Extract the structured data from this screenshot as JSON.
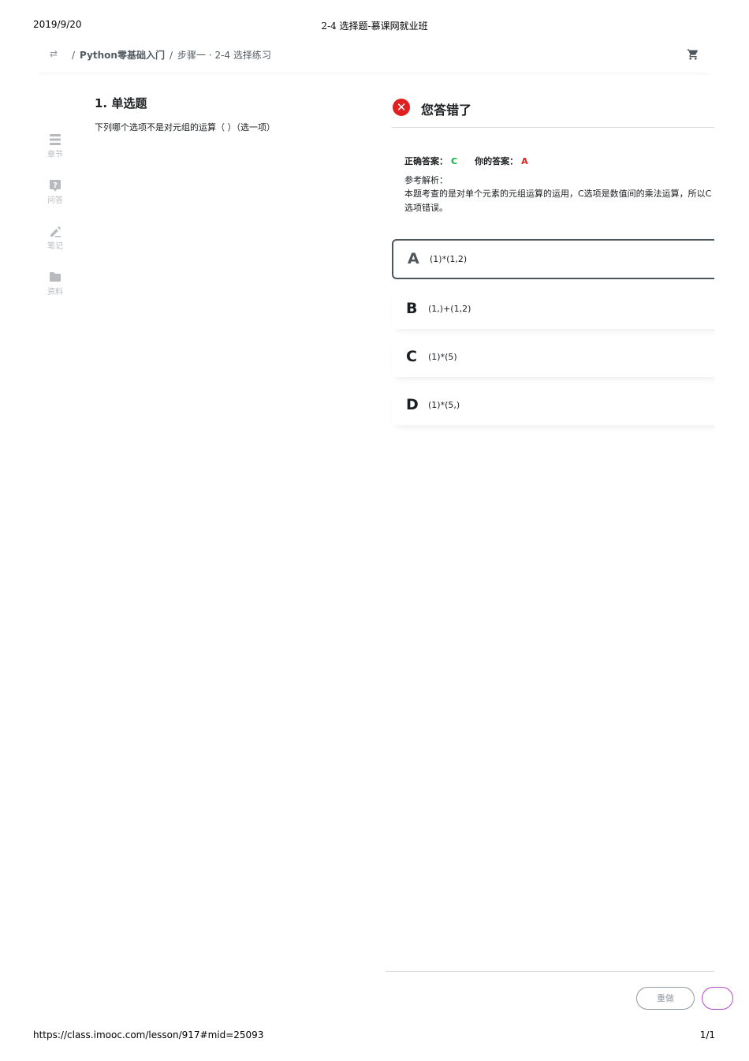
{
  "print": {
    "date": "2019/9/20",
    "title": "2-4 选择题-慕课网就业班",
    "url": "https://class.imooc.com/lesson/917#mid=25093",
    "page": "1/1"
  },
  "topbar": {
    "switch_icon": "swap-icon",
    "separator": "/",
    "course": "Python零基础入门",
    "lesson": "步骤一 · 2-4 选择练习",
    "cart_icon": "cart-icon"
  },
  "sidebar": {
    "items": [
      {
        "label": "章节",
        "icon": "list-icon"
      },
      {
        "label": "问答",
        "icon": "question-icon"
      },
      {
        "label": "笔记",
        "icon": "pencil-icon"
      },
      {
        "label": "资料",
        "icon": "folder-icon"
      }
    ]
  },
  "question": {
    "title": "1. 单选题",
    "text": "下列哪个选项不是对元组的运算（ ）（选一项）"
  },
  "result": {
    "status": "您答错了",
    "correct_label": "正确答案：",
    "correct_value": "C",
    "yours_label": "你的答案：",
    "yours_value": "A",
    "analysis_label": "参考解析：",
    "analysis_text": "本题考查的是对单个元素的元组运算的运用，C选项是数值间的乘法运算，所以C选项错误。"
  },
  "options": [
    {
      "letter": "A",
      "text": "(1)*(1,2)",
      "selected": true
    },
    {
      "letter": "B",
      "text": "(1,)+(1,2)",
      "selected": false
    },
    {
      "letter": "C",
      "text": "(1)*(5)",
      "selected": false
    },
    {
      "letter": "D",
      "text": "(1)*(5,)",
      "selected": false
    }
  ],
  "actions": {
    "redo_label": "重做"
  },
  "colors": {
    "correct": "#00b43c",
    "wrong": "#e02020",
    "accent": "#b24dc8"
  }
}
